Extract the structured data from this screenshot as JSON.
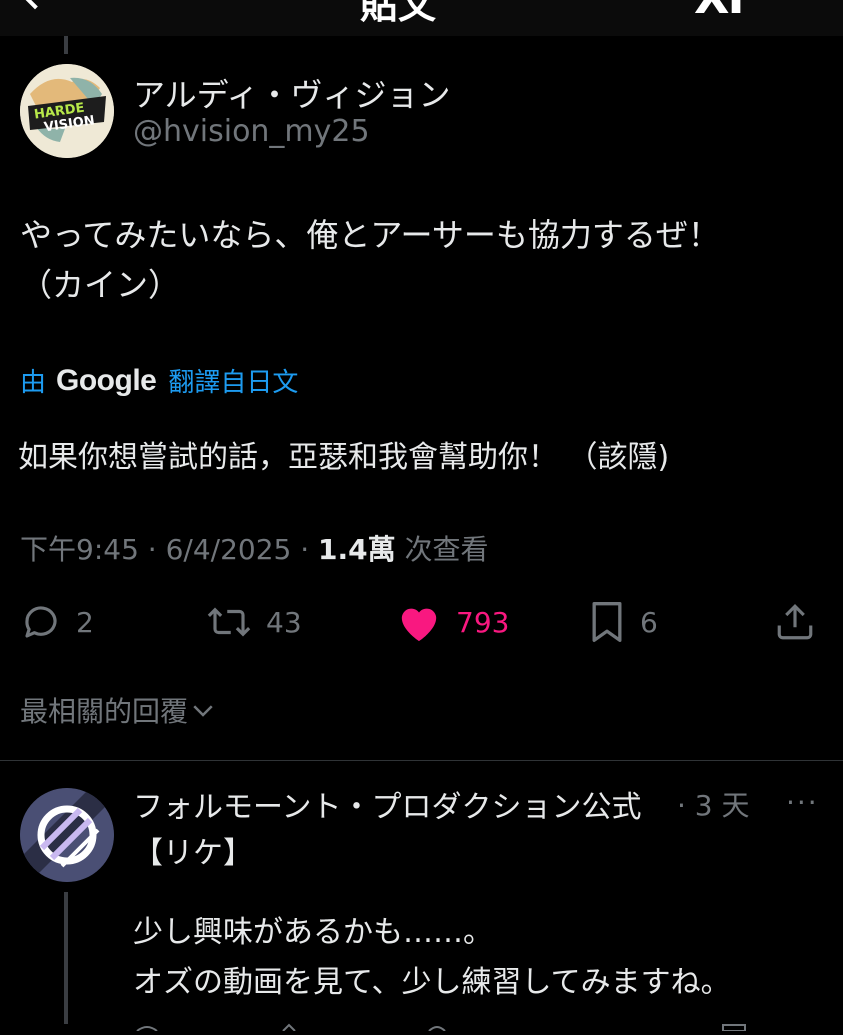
{
  "header": {
    "title": "貼文",
    "brand": "XI"
  },
  "tweet": {
    "display_name": "アルディ・ヴィジョン",
    "handle": "@hvision_my25",
    "text_line1": "やってみたいなら、俺とアーサーも協力するぜ！",
    "text_line2": "（カイン）",
    "translation": {
      "by": "由",
      "provider": "Google",
      "from": "翻譯自日文"
    },
    "translated_text": "如果你想嘗試的話，亞瑟和我會幫助你！ （該隱)",
    "time": "下午9:45 · 6/4/2025 · ",
    "views_count": "1.4萬",
    "views_label": " 次查看",
    "stats": {
      "replies": "2",
      "reposts": "43",
      "likes": "793",
      "bookmarks": "6"
    }
  },
  "replies_sort_label": "最相關的回覆",
  "reply": {
    "display_name": "フォルモーント・プロダクション公式",
    "time": "· 3 天",
    "more": "···",
    "line2": "【リケ】",
    "text_line1": "少し興味があるかも……。",
    "text_line2": "オズの動画を見て、少し練習してみますね。"
  },
  "colors": {
    "accent": "#1d9bf0",
    "like": "#f91880",
    "muted": "#71767b",
    "text": "#e7e9ea",
    "background": "#000000"
  }
}
